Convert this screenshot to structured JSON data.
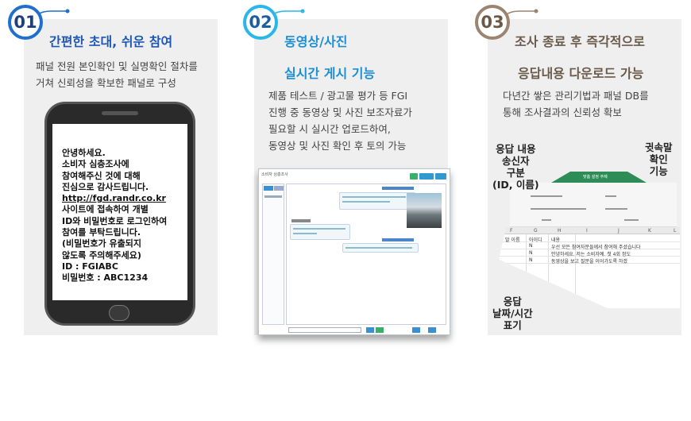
{
  "steps": [
    {
      "number": "01",
      "title": "간편한 초대, 쉬운 참여",
      "desc_lines": [
        "패널 전원 본인확인 및 실명확인 절차를",
        "거쳐 신뢰성을 확보한 패널로 구성"
      ],
      "phone_message": [
        "안녕하세요.",
        "소비자 심층조사에",
        "참여해주신 것에 대해",
        "진심으로 감사드립니다.",
        "http://fgd.randr.co.kr",
        "사이트에 접속하여 개별",
        "ID와 비밀번호로 로그인하여",
        "참여를 부탁드립니다.",
        "(비밀번호가 유출되지",
        "않도록 주의해주세요)",
        "ID : FGIABC",
        "비밀번호 : ABC1234"
      ]
    },
    {
      "number": "02",
      "title_line1": "동영상/사진",
      "title_line2": "실시간 게시 기능",
      "desc_lines": [
        "제품 테스트 / 광고물 평가 등 FGI",
        "진행 중 동영상 및 사진 보조자료가",
        "필요할 시 실시간 업로드하여,",
        "동영상 및 사진 확인 후 토의 가능"
      ],
      "screenshot_title": "소비자 심층조사"
    },
    {
      "number": "03",
      "title_line1": "조사 종료 후 즉각적으로",
      "title_line2": "응답내용 다운로드 가능",
      "desc_lines": [
        "다년간 쌓은 관리기법과  패널 DB를",
        "통해 조사결과의 신뢰성 확보"
      ],
      "label_left": [
        "응답 내용",
        "송신자",
        "구분",
        "(ID, 이름)"
      ],
      "label_right": [
        "귓속말",
        "확인",
        "기능"
      ],
      "label_bottom": [
        "응답",
        "날짜/시간",
        "표기"
      ],
      "excel": {
        "ribbon_tab": "맞춤 설정 주제",
        "columns": [
          "F",
          "G",
          "H",
          "I",
          "J",
          "K",
          "L"
        ],
        "header_row": [
          "말 이름",
          "아이디",
          "내용"
        ],
        "rows": [
          [
            "N",
            "우선 모든 참여자분들께서 참여해 주셨습니다"
          ],
          [
            "N",
            "안녕하세요. 저는 소비자예. 첫 4회 정도"
          ],
          [
            "N",
            "동영상을 보고 질문을 이어가도록 하겠"
          ]
        ]
      }
    }
  ],
  "colors": {
    "blue": "#1f57b5",
    "cyan": "#1c8ed1",
    "brown": "#6a5a4a",
    "card_bg": "#efefef"
  }
}
